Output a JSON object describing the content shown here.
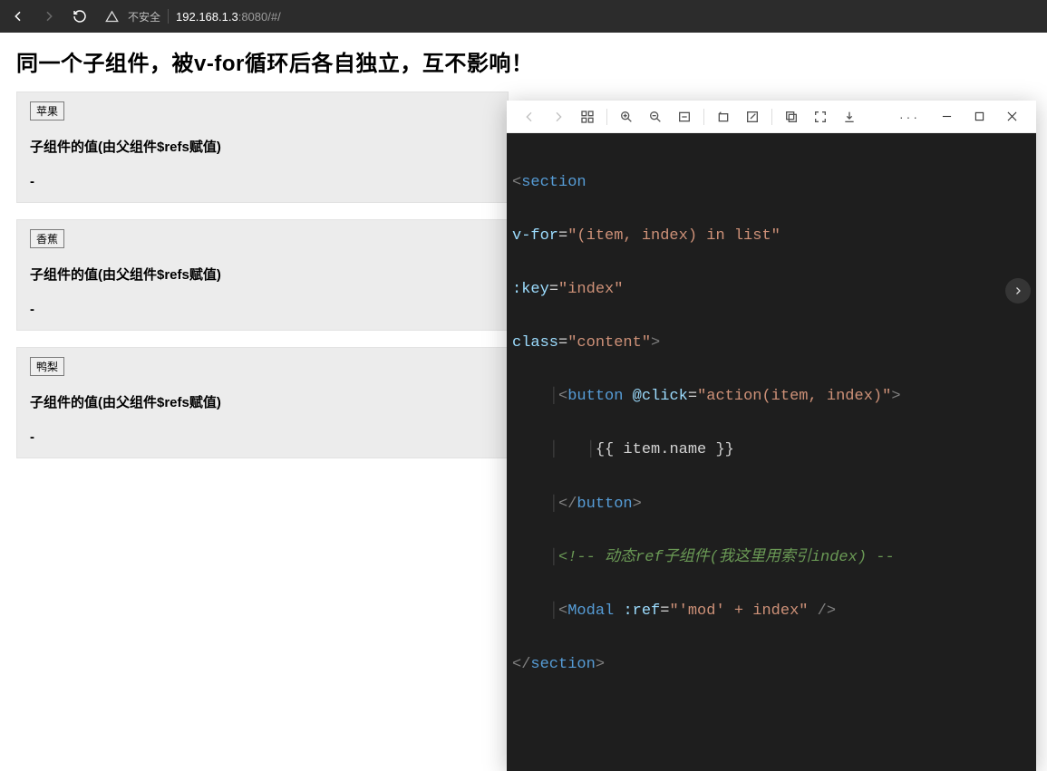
{
  "browser": {
    "insecure_label": "不安全",
    "url_host": "192.168.1.3",
    "url_port": ":8080",
    "url_path": "/#/"
  },
  "page": {
    "title": "同一个子组件，被v-for循环后各自独立，互不影响！",
    "sub_title": "子组件的值(由父组件$refs赋值)",
    "dash": "-",
    "items": [
      {
        "name": "苹果"
      },
      {
        "name": "香蕉"
      },
      {
        "name": "鸭梨"
      }
    ]
  },
  "code": {
    "l1_tag": "section",
    "l2_attr": "v-for",
    "l2_val": "\"(item, index) in list\"",
    "l3_attr": ":key",
    "l3_val": "\"index\"",
    "l4_attr": "class",
    "l4_val": "\"content\"",
    "l5_tag": "button",
    "l5_attr": "@click",
    "l5_val": "\"action(item, index)\"",
    "l6_text": "{{ item.name }}",
    "l7_tag": "button",
    "l8_comment": "<!-- 动态ref子组件(我这里用索引index) --",
    "l9_tag": "Modal",
    "l9_attr": ":ref",
    "l9_val": "\"'mod' + index\"",
    "l10_tag": "section"
  },
  "viewer": {
    "more": "···"
  }
}
